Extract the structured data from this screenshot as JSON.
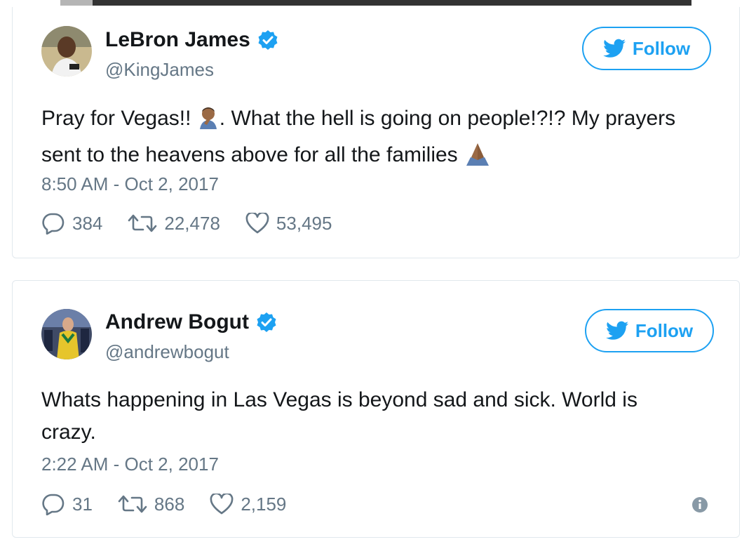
{
  "tweets": [
    {
      "display_name": "LeBron James",
      "handle": "@KingJames",
      "follow_label": "Follow",
      "text_before_emoji": "Pray for Vegas!! ",
      "text_middle": ". What the hell is going on people!?!? My prayers sent to the heavens above for all the families ",
      "timestamp": "8:50 AM - Oct 2, 2017",
      "replies": "384",
      "retweets": "22,478",
      "likes": "53,495"
    },
    {
      "display_name": "Andrew Bogut",
      "handle": "@andrewbogut",
      "follow_label": "Follow",
      "text": "Whats happening in Las Vegas is beyond sad and sick. World is crazy.",
      "timestamp": "2:22 AM - Oct 2, 2017",
      "replies": "31",
      "retweets": "868",
      "likes": "2,159"
    }
  ],
  "colors": {
    "brand_blue": "#1da1f2",
    "muted_text": "#657786",
    "border": "#e1e8ed"
  },
  "icons": [
    "verified-icon",
    "twitter-bird-icon",
    "reply-icon",
    "retweet-icon",
    "like-icon",
    "info-icon",
    "facepalm-emoji",
    "pray-emoji"
  ]
}
